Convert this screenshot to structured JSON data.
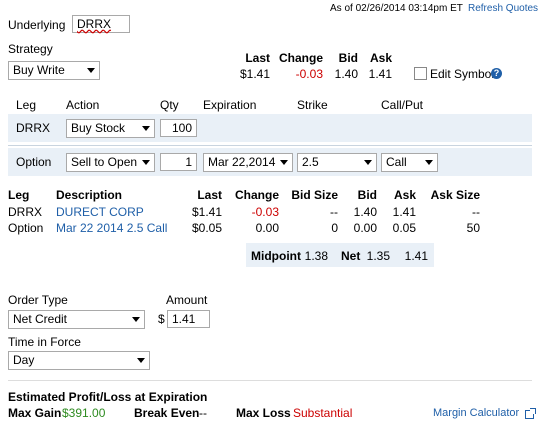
{
  "header": {
    "as_of": "As of 02/26/2014 03:14pm ET",
    "refresh_quotes": "Refresh Quotes"
  },
  "underlying": {
    "label": "Underlying",
    "value": "DRRX"
  },
  "strategy": {
    "label": "Strategy",
    "selected": "Buy Write"
  },
  "quote": {
    "headers": [
      "Last",
      "Change",
      "Bid",
      "Ask"
    ],
    "last": "$1.41",
    "change": "-0.03",
    "bid": "1.40",
    "ask": "1.41",
    "edit_symbol_label": "Edit Symbol",
    "edit_symbol_checked": false
  },
  "legs_form": {
    "headers": [
      "Leg",
      "Action",
      "Qty",
      "Expiration",
      "Strike",
      "Call/Put"
    ],
    "stock_leg": {
      "leg": "DRRX",
      "action": "Buy Stock",
      "qty": "100"
    },
    "option_leg": {
      "leg": "Option",
      "action": "Sell to Open",
      "qty": "1",
      "expiration": "Mar 22,2014",
      "strike": "2.5",
      "call_put": "Call"
    }
  },
  "leg_quotes": {
    "headers": [
      "Leg",
      "Description",
      "Last",
      "Change",
      "Bid Size",
      "Bid",
      "Ask",
      "Ask Size"
    ],
    "rows": [
      {
        "leg": "DRRX",
        "description": "DURECT CORP",
        "last": "$1.41",
        "change": "-0.03",
        "bid_size": "--",
        "bid": "1.40",
        "ask": "1.41",
        "ask_size": "--"
      },
      {
        "leg": "Option",
        "description": "Mar 22 2014 2.5 Call",
        "last": "$0.05",
        "change": "0.00",
        "bid_size": "0",
        "bid": "0.00",
        "ask": "0.05",
        "ask_size": "50"
      }
    ],
    "summary": {
      "midpoint_label": "Midpoint",
      "midpoint": "1.38",
      "net_label": "Net",
      "net_bid": "1.35",
      "net_ask": "1.41"
    }
  },
  "order": {
    "order_type_label": "Order Type",
    "order_type": "Net Credit",
    "amount_label": "Amount",
    "currency": "$",
    "amount": "1.41",
    "tif_label": "Time in Force",
    "tif": "Day"
  },
  "estimate": {
    "title": "Estimated Profit/Loss at Expiration",
    "max_gain_label": "Max Gain",
    "max_gain": "$391.00",
    "break_even_label": "Break Even",
    "break_even": "--",
    "max_loss_label": "Max Loss",
    "max_loss": "Substantial",
    "margin_calculator": "Margin Calculator"
  },
  "colors": {
    "link": "#1f5fa8",
    "negative": "#cc0000",
    "positive": "#2e8b20",
    "band": "#e9f0f7"
  }
}
